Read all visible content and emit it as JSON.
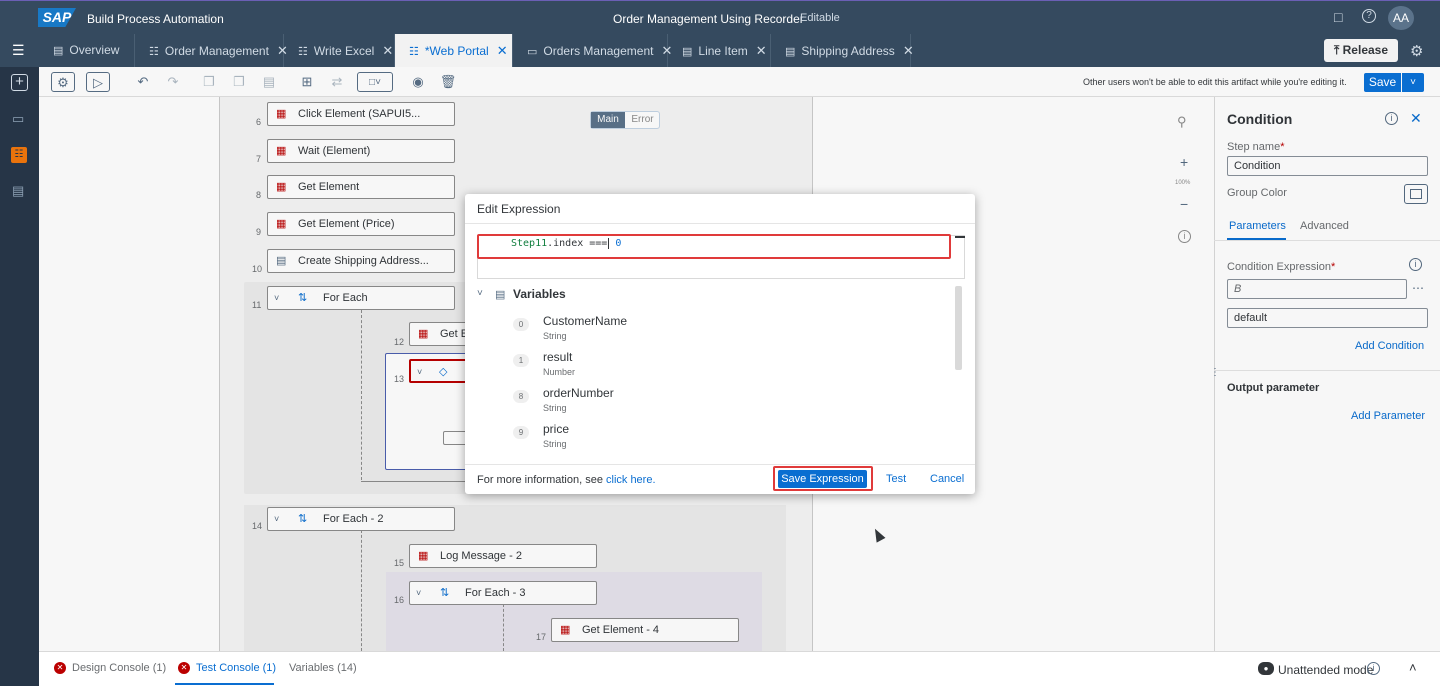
{
  "header": {
    "logo": "SAP",
    "app_name": "Build Process Automation",
    "project_title": "Order Management Using Recorder",
    "status": "Editable",
    "avatar": "AA"
  },
  "tabs": [
    {
      "label": "Overview"
    },
    {
      "label": "Order Management"
    },
    {
      "label": "Write Excel"
    },
    {
      "label": "*Web Portal"
    },
    {
      "label": "Orders Management"
    },
    {
      "label": "Line Item"
    },
    {
      "label": "Shipping Address"
    }
  ],
  "release_label": "Release",
  "toolbar": {
    "notice": "Other users won't be able to edit this artifact while you're editing it.",
    "save_label": "Save"
  },
  "canvas": {
    "switch_main": "Main",
    "switch_error": "Error",
    "zoom": "100%",
    "steps": [
      {
        "num": "6",
        "label": "Click Element (SAPUI5..."
      },
      {
        "num": "7",
        "label": "Wait (Element)"
      },
      {
        "num": "8",
        "label": "Get Element"
      },
      {
        "num": "9",
        "label": "Get Element (Price)"
      },
      {
        "num": "10",
        "label": "Create Shipping Address..."
      },
      {
        "num": "11",
        "label": "For Each"
      },
      {
        "num": "12",
        "label": "Get E"
      },
      {
        "num": "13",
        "label": ""
      },
      {
        "num": "14",
        "label": "For Each - 2"
      },
      {
        "num": "15",
        "label": "Log Message - 2"
      },
      {
        "num": "16",
        "label": "For Each - 3"
      },
      {
        "num": "17",
        "label": "Get Element - 4"
      }
    ]
  },
  "panel": {
    "title": "Condition",
    "step_name_label": "Step name",
    "step_name_value": "Condition",
    "group_color_label": "Group Color",
    "tab_parameters": "Parameters",
    "tab_advanced": "Advanced",
    "condition_expr_label": "Condition Expression",
    "condition_expr_value": "B",
    "default_value": "default",
    "add_condition": "Add Condition",
    "output_param_label": "Output parameter",
    "add_parameter": "Add Parameter"
  },
  "dialog": {
    "title": "Edit Expression",
    "expr_var": "Step11",
    "expr_op": ".index ===",
    "expr_val": "0",
    "variables_label": "Variables",
    "variables": [
      {
        "idx": "0",
        "name": "CustomerName",
        "type": "String"
      },
      {
        "idx": "1",
        "name": "result",
        "type": "Number"
      },
      {
        "idx": "8",
        "name": "orderNumber",
        "type": "String"
      },
      {
        "idx": "9",
        "name": "price",
        "type": "String"
      }
    ],
    "info_text": "For more information, see",
    "info_link": "click here.",
    "save_label": "Save Expression",
    "test_label": "Test",
    "cancel_label": "Cancel"
  },
  "bottom": {
    "design_console": "Design Console (1)",
    "test_console": "Test Console (1)",
    "variables": "Variables (14)",
    "mode": "Unattended mode"
  }
}
